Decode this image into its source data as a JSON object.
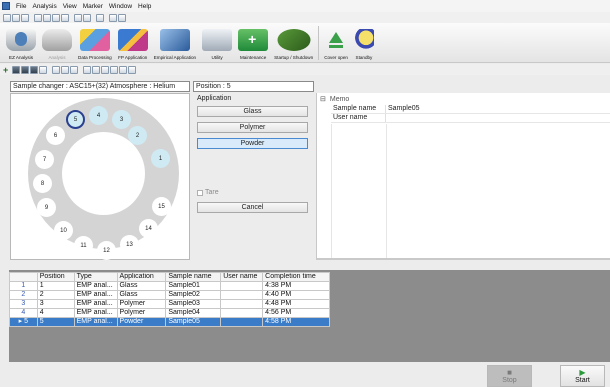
{
  "menu": [
    "File",
    "Analysis",
    "View",
    "Marker",
    "Window",
    "Help"
  ],
  "toolbar": {
    "ez_analysis": "EZ Analysis",
    "analysis": "Analysis",
    "data_processing": "Data Processing",
    "fp_application": "FP Application",
    "empirical_application": "Empirical Application",
    "utility": "Utility",
    "maintenance": "Maintenance",
    "startup_shutdown": "Startup / Shutdown",
    "cover_open": "Cover open",
    "standby": "Standby"
  },
  "changer": {
    "header": "Sample changer : ASC15+(32)  Atmosphere : Helium",
    "positions": [
      "1",
      "2",
      "3",
      "4",
      "5",
      "6",
      "7",
      "8",
      "9",
      "10",
      "11",
      "12",
      "13",
      "14",
      "15"
    ],
    "selected": "5",
    "filled": [
      "1",
      "2",
      "3",
      "4",
      "5"
    ]
  },
  "position_header": "Position : 5",
  "application": {
    "title": "Application",
    "glass": "Glass",
    "polymer": "Polymer",
    "powder": "Powder",
    "tare": "Tare",
    "cancel": "Cancel"
  },
  "memo": {
    "title": "Memo",
    "collapse": "⊟",
    "sample_name_label": "Sample name",
    "sample_name_value": "Sample05",
    "user_name_label": "User name",
    "user_name_value": ""
  },
  "table": {
    "headers": [
      "",
      "Position",
      "Type",
      "Application",
      "Sample name",
      "User name",
      "Completion time"
    ],
    "rows": [
      {
        "idx": "1",
        "position": "1",
        "type": "EMP anal...",
        "application": "Glass",
        "sample": "Sample01",
        "user": "",
        "time": "4:38 PM"
      },
      {
        "idx": "2",
        "position": "2",
        "type": "EMP anal...",
        "application": "Glass",
        "sample": "Sample02",
        "user": "",
        "time": "4:40 PM"
      },
      {
        "idx": "3",
        "position": "3",
        "type": "EMP anal...",
        "application": "Polymer",
        "sample": "Sample03",
        "user": "",
        "time": "4:48 PM"
      },
      {
        "idx": "4",
        "position": "4",
        "type": "EMP anal...",
        "application": "Polymer",
        "sample": "Sample04",
        "user": "",
        "time": "4:56 PM"
      },
      {
        "idx": "5",
        "position": "5",
        "type": "EMP anal...",
        "application": "Powder",
        "sample": "Sample05",
        "user": "",
        "time": "4:58 PM"
      }
    ],
    "current_marker": "▸"
  },
  "buttons": {
    "stop": "Stop",
    "start": "Start",
    "stop_glyph": "■",
    "start_glyph": "▶"
  },
  "colors": {
    "selected_row": "#3a7cc8",
    "filled_position": "#cfeaf3",
    "selected_ring": "#2a3f8f"
  }
}
